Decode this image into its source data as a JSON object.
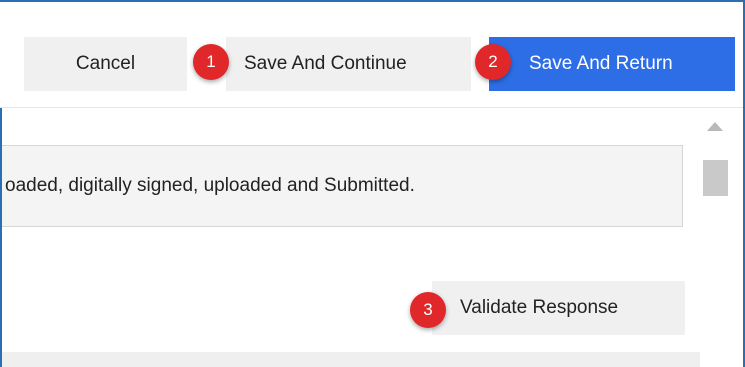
{
  "toolbar": {
    "cancel_label": "Cancel",
    "save_continue_label": "Save And Continue",
    "save_return_label": "Save And Return"
  },
  "badges": {
    "one": "1",
    "two": "2",
    "three": "3"
  },
  "content": {
    "message": "oaded, digitally signed, uploaded and Submitted.",
    "validate_label": "Validate Response"
  },
  "colors": {
    "primary_button": "#2d6ee6",
    "badge": "#e0272a",
    "frame_border": "#2a6fb0"
  },
  "icons": {
    "scroll_up": "triangle-up"
  }
}
